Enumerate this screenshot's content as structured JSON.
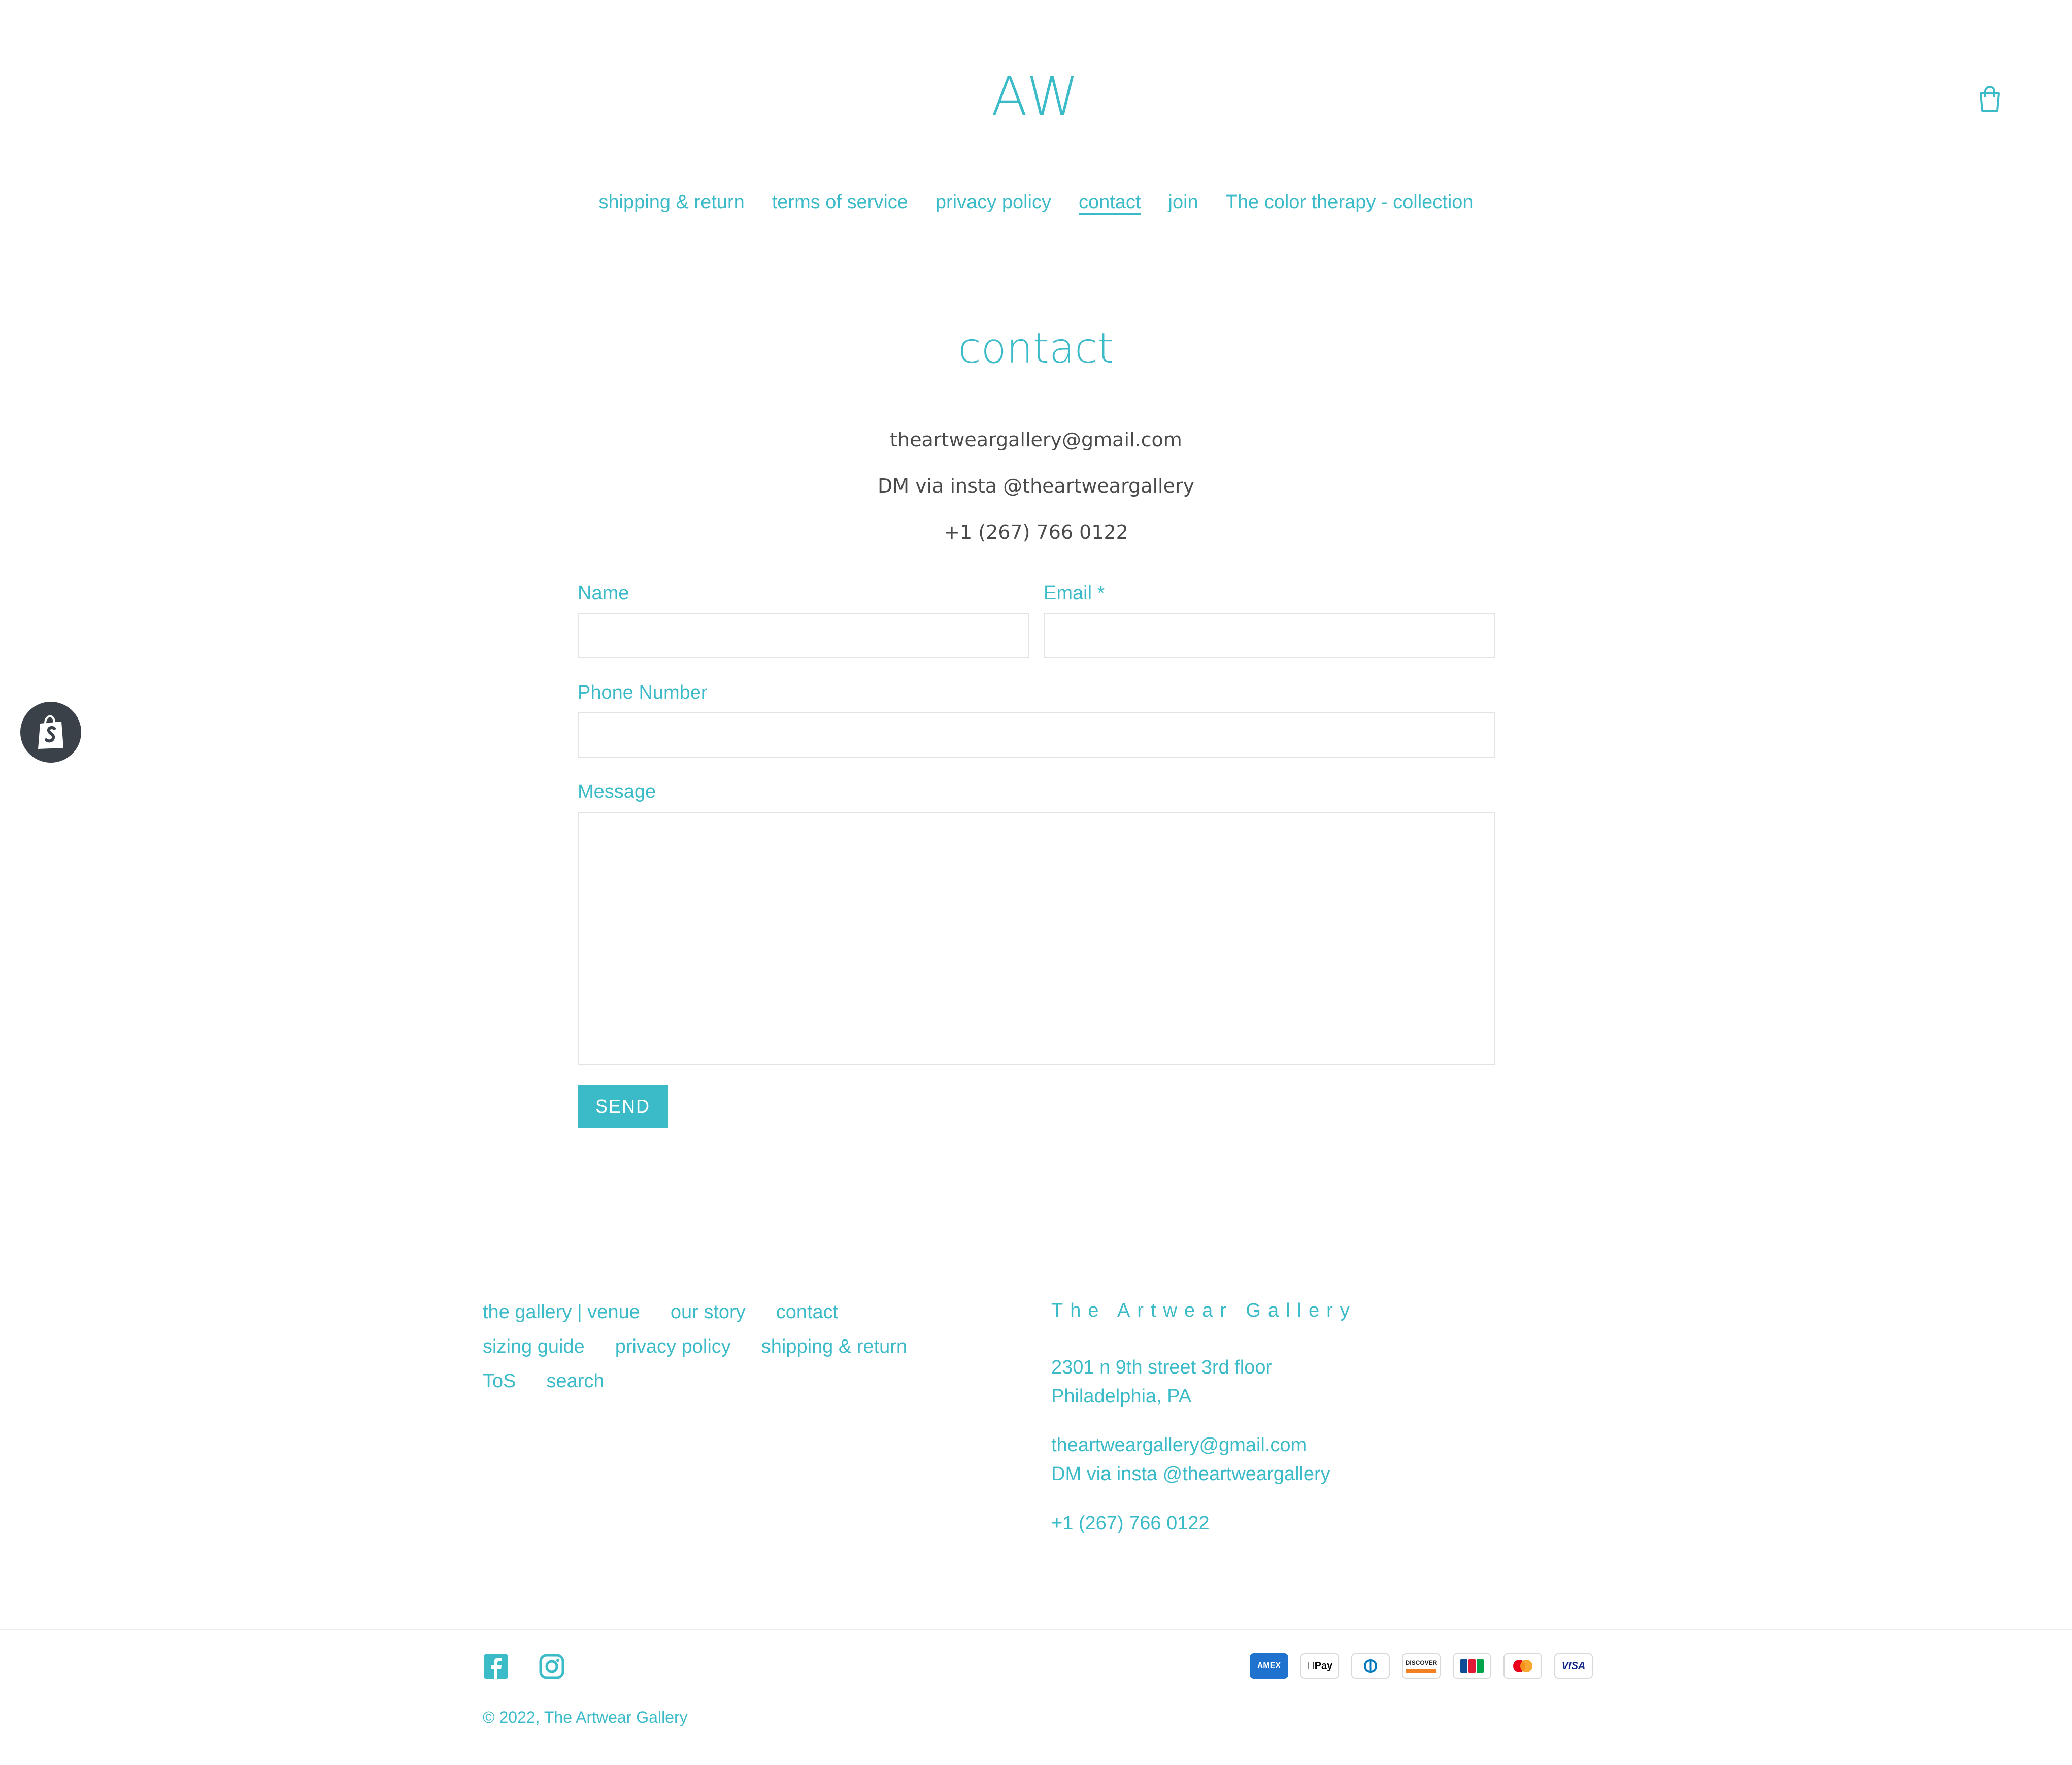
{
  "header": {
    "logo": "AW",
    "nav": [
      {
        "label": "shipping & return"
      },
      {
        "label": "terms of service"
      },
      {
        "label": "privacy policy"
      },
      {
        "label": "contact",
        "active": true
      },
      {
        "label": "join"
      },
      {
        "label": "The color therapy - collection"
      }
    ],
    "cart_icon": "cart-icon"
  },
  "contact": {
    "title": "contact",
    "email": "theartweargallery@gmail.com",
    "insta": "DM via insta @theartweargallery",
    "phone": "+1 (267) 766 0122"
  },
  "form": {
    "name_label": "Name",
    "email_label": "Email *",
    "phone_label": "Phone Number",
    "message_label": "Message",
    "send_label": "SEND",
    "name_value": "",
    "email_value": "",
    "phone_value": "",
    "message_value": ""
  },
  "footer": {
    "links_row1": [
      "the gallery | venue",
      "our story",
      "contact"
    ],
    "links_row2": [
      "sizing guide",
      "privacy policy",
      "shipping & return"
    ],
    "links_row3": [
      "ToS",
      "search"
    ],
    "brand": "The Artwear Gallery",
    "address_line1": "2301 n 9th street 3rd floor",
    "address_line2": "Philadelphia, PA",
    "email": "theartweargallery@gmail.com",
    "insta": "DM via insta @theartweargallery",
    "phone": "+1 (267) 766 0122",
    "copyright_prefix": "© 2022,",
    "copyright_name": "The Artwear Gallery",
    "social": [
      "facebook-icon",
      "instagram-icon"
    ],
    "payments": [
      "AMEX",
      "Pay",
      "Diners",
      "DISCOVER",
      "JCB",
      "Mastercard",
      "VISA"
    ]
  },
  "colors": {
    "accent": "#3bbac8",
    "body_text": "#4a4a4a",
    "badge_dark": "#3a4148"
  }
}
